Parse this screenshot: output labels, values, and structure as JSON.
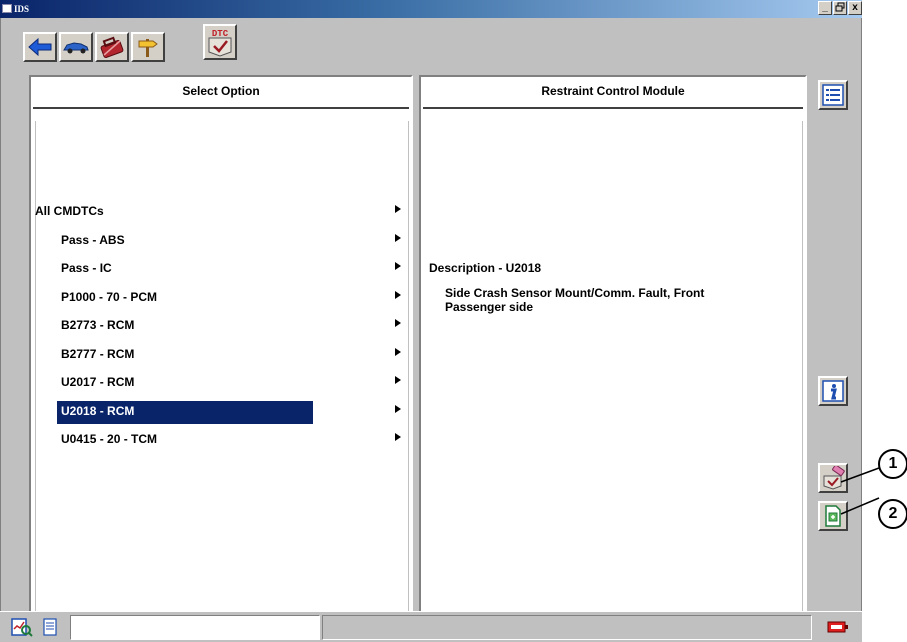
{
  "window": {
    "title": "IDS",
    "buttons": [
      "_",
      " ",
      "x"
    ]
  },
  "toolbar": {
    "icons": [
      "back-arrow-icon",
      "vehicle-icon",
      "toolbox-icon",
      "signpost-icon"
    ],
    "dtc_label": "DTC"
  },
  "left_panel": {
    "header": "Select Option",
    "items": [
      {
        "label": "All CMDTCs",
        "level": "top"
      },
      {
        "label": "Pass - ABS",
        "level": "sub"
      },
      {
        "label": "Pass - IC",
        "level": "sub"
      },
      {
        "label": "P1000 - 70 - PCM",
        "level": "sub"
      },
      {
        "label": "B2773 - RCM",
        "level": "sub"
      },
      {
        "label": "B2777 - RCM",
        "level": "sub"
      },
      {
        "label": "U2017 - RCM",
        "level": "sub"
      },
      {
        "label": "U2018 - RCM",
        "level": "sub",
        "selected": true
      },
      {
        "label": "U0415 - 20 - TCM",
        "level": "sub"
      }
    ]
  },
  "right_panel": {
    "header": "Restraint Control Module",
    "description_title": "Description - U2018",
    "description_body": "Side Crash Sensor Mount/Comm. Fault, Front Passenger side"
  },
  "callouts": [
    "1",
    "2"
  ],
  "colors": {
    "selection": "#0a246a",
    "face": "#c0c0c0"
  }
}
